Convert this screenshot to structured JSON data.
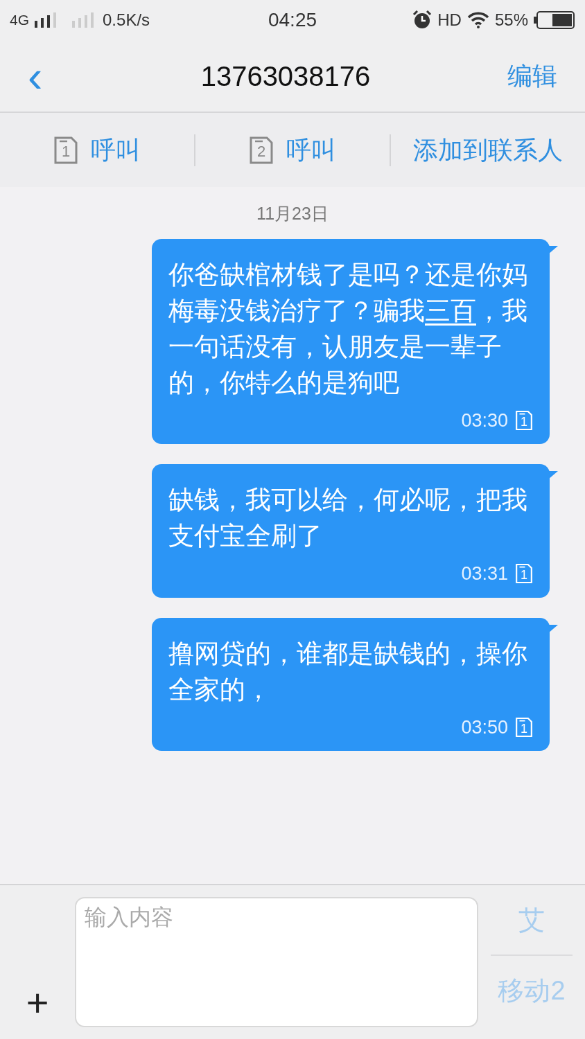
{
  "status_bar": {
    "network": "4G",
    "speed": "0.5K/s",
    "time": "04:25",
    "hd": "HD",
    "battery": "55%"
  },
  "header": {
    "back": "‹",
    "title": "13763038176",
    "edit": "编辑"
  },
  "actions": [
    {
      "kind": "call",
      "sim": "1",
      "label": "呼叫"
    },
    {
      "kind": "call",
      "sim": "2",
      "label": "呼叫"
    },
    {
      "kind": "add",
      "label": "添加到联系人"
    }
  ],
  "date": "11月23日",
  "messages": [
    {
      "parts": [
        {
          "text": "你爸缺棺材钱了是吗？还是你妈梅毒没钱治疗了？骗我",
          "link": false
        },
        {
          "text": "三百",
          "link": true
        },
        {
          "text": "，我一句话没有，认朋友是一辈子的，你特么的是狗吧",
          "link": false
        }
      ],
      "time": "03:30",
      "sim": "1"
    },
    {
      "parts": [
        {
          "text": "缺钱，我可以给，何必呢，把我支付宝全刷了",
          "link": false
        }
      ],
      "time": "03:31",
      "sim": "1"
    },
    {
      "parts": [
        {
          "text": "撸网贷的，谁都是缺钱的，操你全家的，",
          "link": false
        }
      ],
      "time": "03:50",
      "sim": "1"
    }
  ],
  "composer": {
    "add": "+",
    "placeholder": "输入内容",
    "send_buttons": [
      {
        "label": "艾",
        "disabled": true
      },
      {
        "label": "移动2",
        "disabled": true
      }
    ]
  }
}
